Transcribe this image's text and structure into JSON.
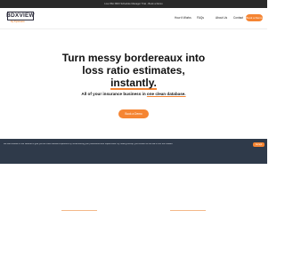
{
  "announcement": {
    "text": "Live P&C BDX Schedule Manager Trial - Book a Demo"
  },
  "header": {
    "logo": {
      "name": "BDXVIEW",
      "tagline": "by Cynosure"
    },
    "nav": [
      {
        "label": "How it Works"
      },
      {
        "label": "FAQs"
      },
      {
        "label": "About Us"
      },
      {
        "label": "Contact"
      }
    ],
    "cta_label": "Book a Demo"
  },
  "hero": {
    "title_line_1": "Turn messy bordereaux into",
    "title_line_2": "loss ratio estimates,",
    "title_line_3": "instantly.",
    "subhead_prefix": "All of your insurance business in ",
    "subhead_emphasis": "one clean database.",
    "button_label": "Book a Demo"
  },
  "cookie_banner": {
    "text": "We use cookies on our website to give you the most relevant experience by remembering your preferences and repeat visits. By clicking Accept, you consent to the use of ALL the cookies.",
    "accept_label": "Accept"
  },
  "colors": {
    "accent": "#f58533",
    "banner_bg": "#2f3a4a",
    "topbar_bg": "#2a2a2a"
  }
}
